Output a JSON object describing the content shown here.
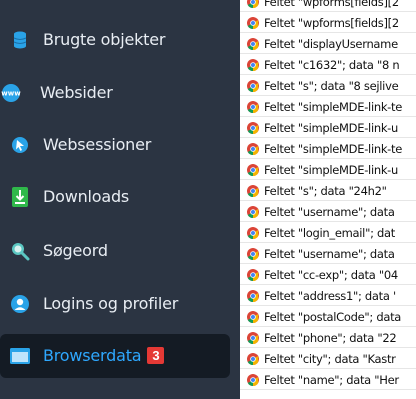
{
  "sidebar": {
    "items": [
      {
        "label": "Brugte objekter",
        "icon": "database-icon",
        "color": "#2aa3e8"
      },
      {
        "label": "Websider",
        "icon": "www-globe-icon",
        "color": "#2aa3e8"
      },
      {
        "label": "Websessioner",
        "icon": "web-session-icon",
        "color": "#2aa3e8"
      },
      {
        "label": "Downloads",
        "icon": "download-icon",
        "color": "#2fb84a"
      },
      {
        "label": "Søgeord",
        "icon": "magnifier-icon",
        "color": "#5bc7c2"
      },
      {
        "label": "Logins og profiler",
        "icon": "user-icon",
        "color": "#2aa3e8"
      },
      {
        "label": "Browserdata",
        "icon": "browser-window-icon",
        "color": "#2aa3e8",
        "badge": "3",
        "active": true
      }
    ]
  },
  "records": [
    "Feltet \"wpforms[fields][2",
    "Feltet \"wpforms[fields][2",
    "Feltet \"displayUsername",
    "Feltet \"c1632\"; data \"8 n",
    "Feltet \"s\"; data \"8 sejlive",
    "Feltet \"simpleMDE-link-te",
    "Feltet \"simpleMDE-link-u",
    "Feltet \"simpleMDE-link-te",
    "Feltet \"simpleMDE-link-u",
    "Feltet \"s\"; data \"24h2\"",
    "Feltet \"username\"; data",
    "Feltet \"login_email\"; dat",
    "Feltet \"username\"; data",
    "Feltet \"cc-exp\"; data \"04",
    "Feltet \"address1\"; data '",
    "Feltet \"postalCode\"; data",
    "Feltet \"phone\"; data \"22",
    "Feltet \"city\"; data \"Kastr",
    "Feltet \"name\"; data \"Her"
  ],
  "record_icon": "chrome-icon",
  "colors": {
    "accent": "#2ea8ff",
    "badge": "#e53935",
    "sidebar_bg": "#2b3442",
    "active_bg": "#141b24"
  }
}
